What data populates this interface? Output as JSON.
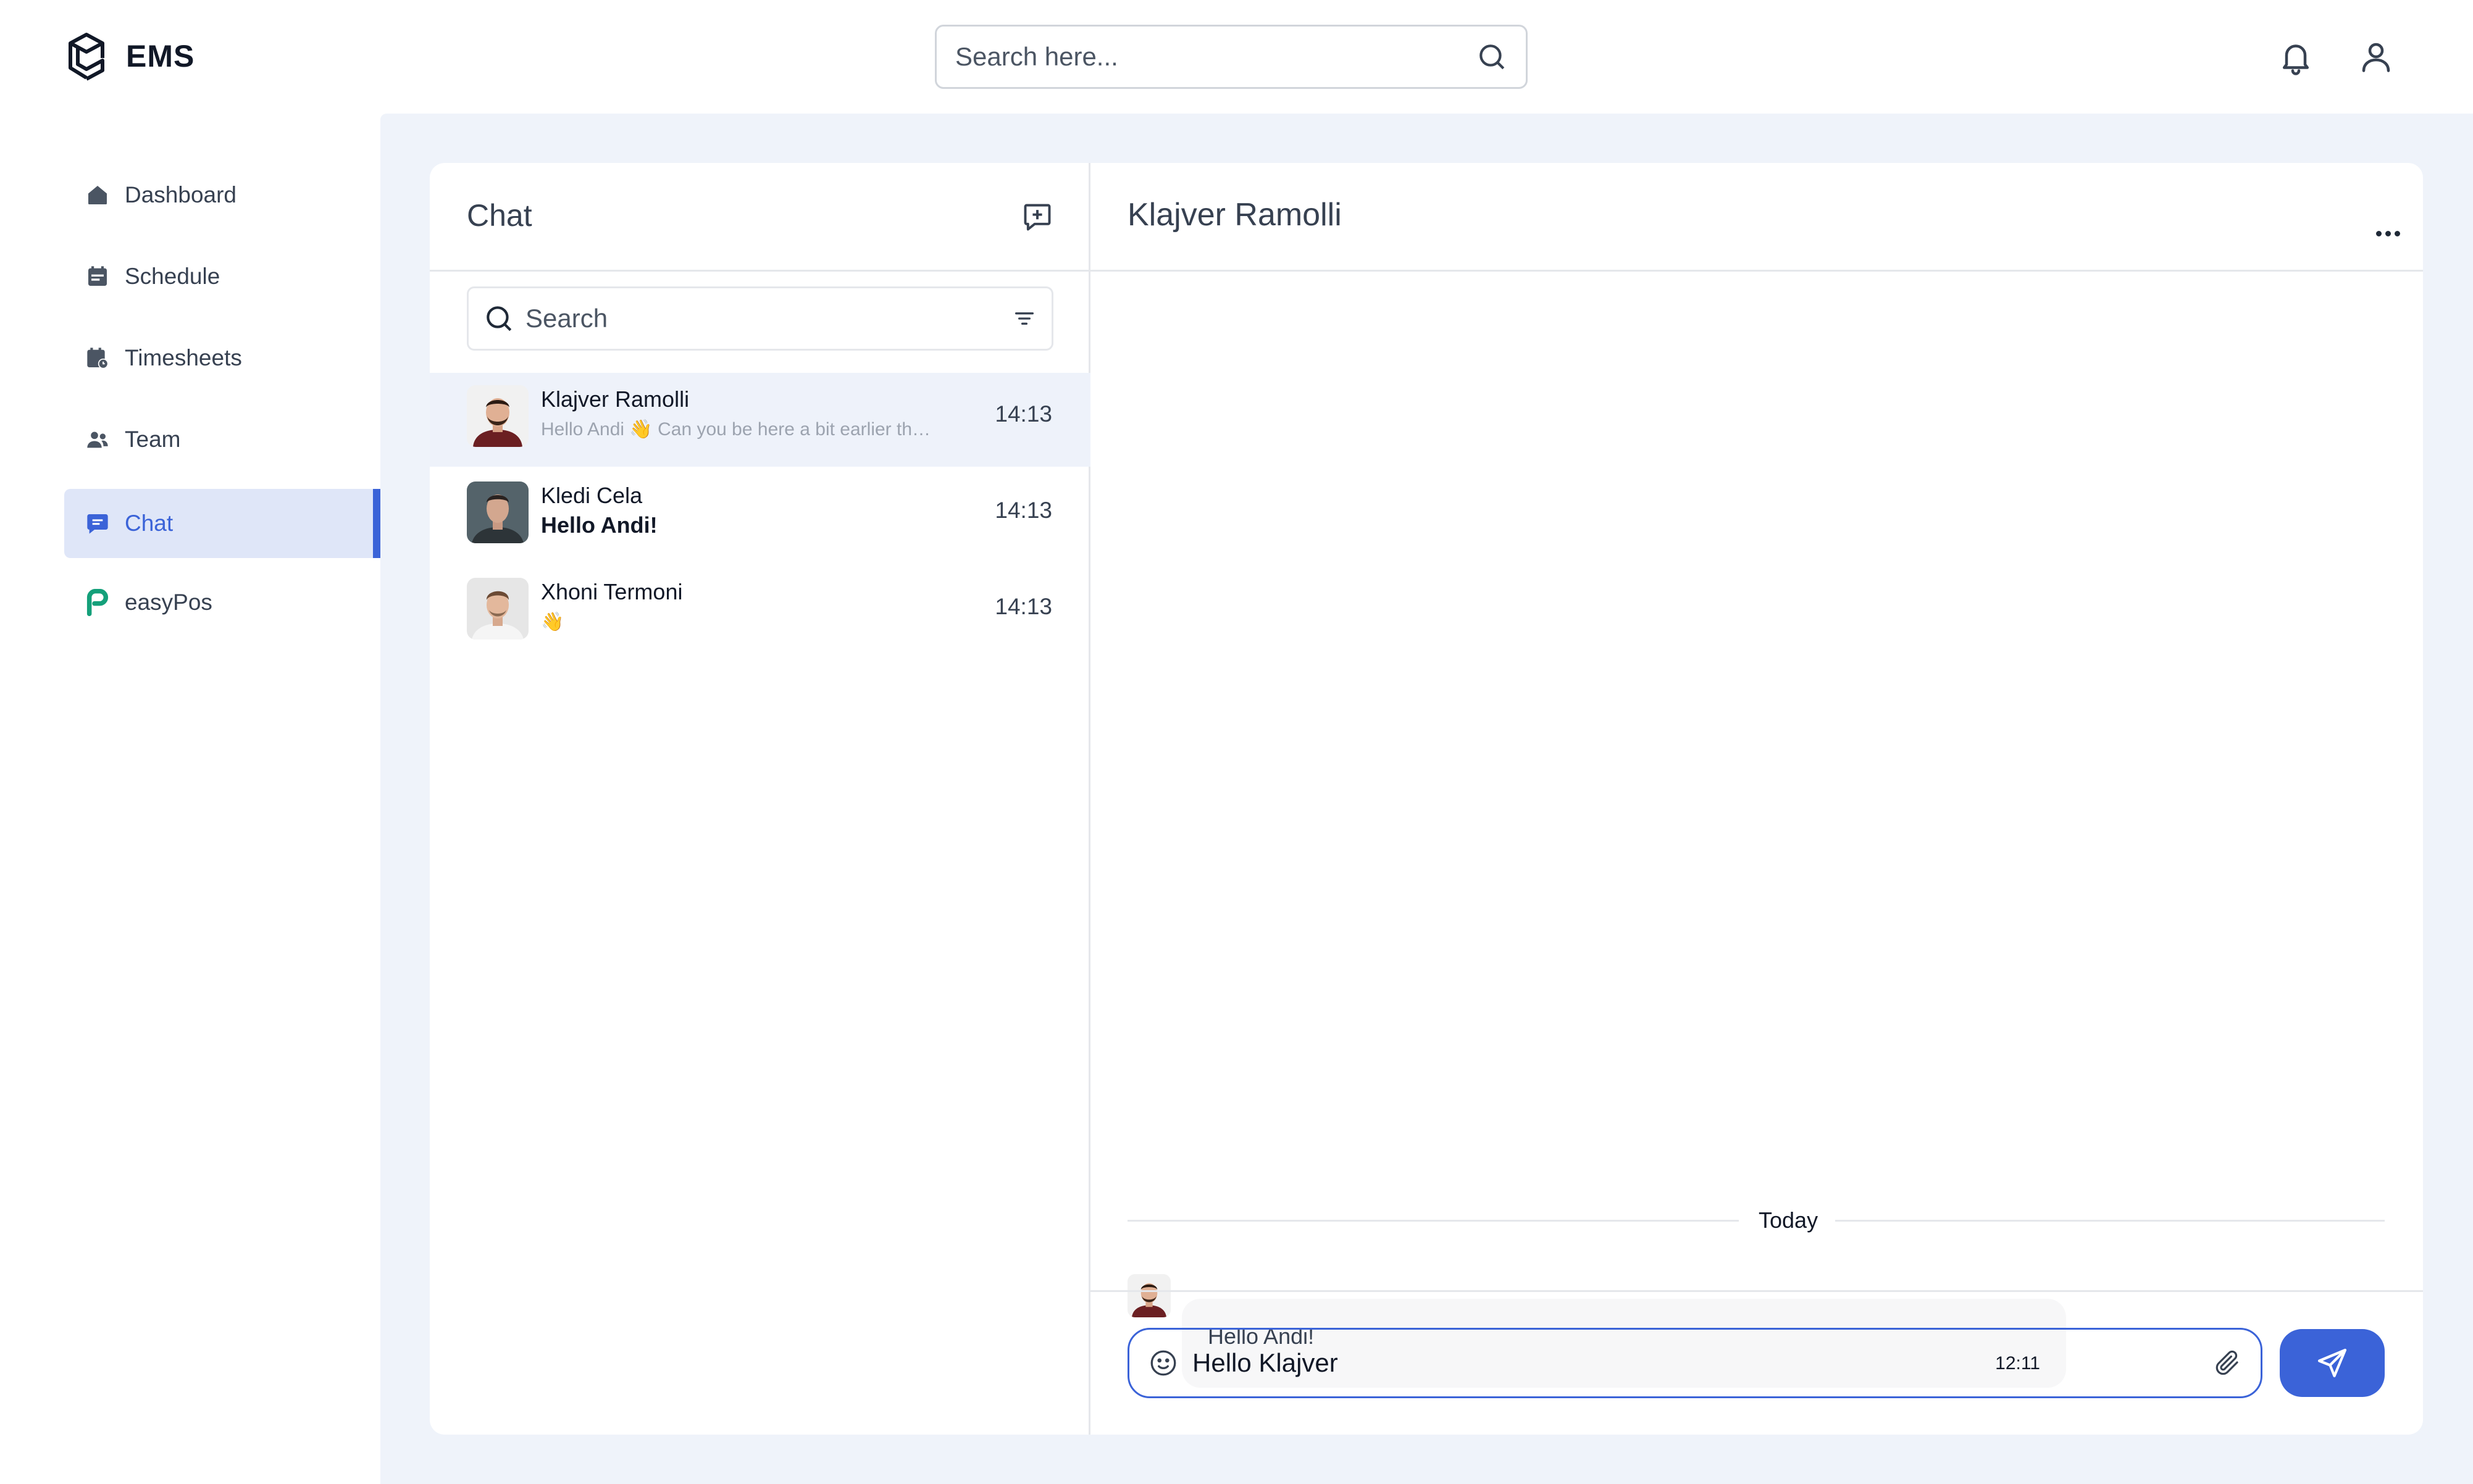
{
  "app": {
    "name": "EMS"
  },
  "topbar": {
    "search_placeholder": "Search here..."
  },
  "sidebar": {
    "items": [
      {
        "label": "Dashboard",
        "icon": "home-icon"
      },
      {
        "label": "Schedule",
        "icon": "calendar-icon"
      },
      {
        "label": "Timesheets",
        "icon": "calendar-clock-icon"
      },
      {
        "label": "Team",
        "icon": "team-icon"
      },
      {
        "label": "Chat",
        "icon": "chat-icon",
        "active": true
      },
      {
        "label": "easyPos",
        "icon": "easypos-logo-icon"
      }
    ]
  },
  "chat_list": {
    "title": "Chat",
    "search_placeholder": "Search",
    "conversations": [
      {
        "name": "Klajver Ramolli",
        "preview": "Hello Andi 👋 Can you be here a bit earlier than usual?",
        "time": "14:13",
        "selected": true
      },
      {
        "name": "Kledi Cela",
        "preview": "Hello Andi!",
        "time": "14:13",
        "unread": true
      },
      {
        "name": "Xhoni Termoni",
        "preview": "👋",
        "time": "14:13"
      }
    ]
  },
  "conversation": {
    "contact_name": "Klajver Ramolli",
    "day_label": "Today",
    "messages": [
      {
        "text": "Hello Andi!",
        "time": "12:11"
      }
    ],
    "composer_value": "Hello Klajver"
  },
  "colors": {
    "accent": "#3b63d8",
    "background": "#eff3fa",
    "selected_row": "#eef2fa"
  }
}
